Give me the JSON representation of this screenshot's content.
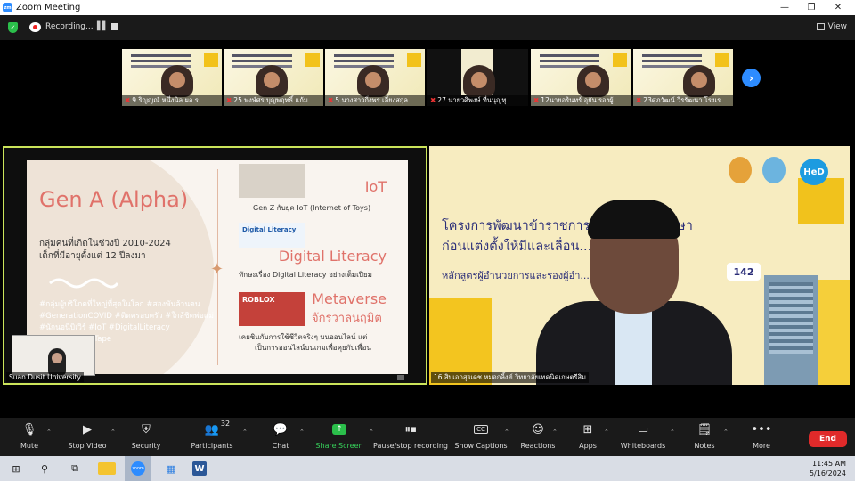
{
  "window": {
    "title": "Zoom Meeting",
    "minimize": "—",
    "restore": "❐",
    "close": "✕"
  },
  "topbar": {
    "recording_label": "Recording...",
    "view_label": "View"
  },
  "thumbnails": [
    {
      "name": "9 ริญญณ์ หนึ่งนิล ผอ.ร..."
    },
    {
      "name": "25 พงษ์ศร บุญพฤทธิ์ แก้ม..."
    },
    {
      "name": "5.นางสาวกิ่งพร เลี้ยงสกุล..."
    },
    {
      "name": "27 นายวศิพงษ์ ที่นนุญทุ..."
    },
    {
      "name": "12นายอรินทร์ อุยัน รองผู้..."
    },
    {
      "name": "23ศุภวัฒน์ วิรรัฒนา โรงเร..."
    }
  ],
  "left_panel": {
    "title": "Gen A (Alpha)",
    "line1": "กลุ่มคนที่เกิดในช่วงปี 2010-2024",
    "line2": "เด็กที่มีอายุตั้งแต่ 12 ปีลงมา",
    "tags": "#กลุ่มผู้บริโภคที่ใหญ่ที่สุดในโลก #สองพันล้านคน #GenerationCOVID #ติดครอบครัว #ใกล้ชิดพ่อแม่ #นักนอนิบิเวิร์ #IoT #DigitalLiteracy #Metaverse #Tape",
    "iot_heading": "IoT",
    "iot_sub": "Gen Z กับยุค IoT (Internet of Toys)",
    "dl_image_text": "Digital Literacy",
    "dl_heading": "Digital Literacy",
    "dl_sub": "ทักษะเรื่อง Digital Literacy อย่างเต็มเปี่ยม",
    "mv_heading": "Metaverse",
    "mv_thai": "จักรวาลนฤมิต",
    "mv_image_text": "ROBLOX",
    "mv_sub1": "เคยชินกับการใช้ชีวิตจริงๆ บนออนไลน์ แต่",
    "mv_sub2": "เป็นการออนไลน์บนเกมเพื่อคุยกับเพื่อน",
    "name_label": "Suan Dusit University"
  },
  "right_panel": {
    "title_line1": "โครงการพัฒนาข้าราชการ...กรทางการศึกษา",
    "title_line2": "ก่อนแต่งตั้งให้มีและเลื่อน...",
    "subtitle": "หลักสูตรผู้อำนวยการและรองผู้อำ...การพิเศษ ระยะที่",
    "badge": "142",
    "hed_logo": "HeD",
    "name_label": "16 สิบเอกสุรเดช  หมอกลิ้งข์ วิทยาลัยเทคนิคเกษตรีสิม"
  },
  "toolbar": {
    "mute": "Mute",
    "stop_video": "Stop Video",
    "security": "Security",
    "participants": "Participants",
    "participants_count": "32",
    "chat": "Chat",
    "share_screen": "Share Screen",
    "pause_recording": "Pause/stop recording",
    "show_captions": "Show Captions",
    "captions_icon_text": "CC",
    "reactions": "Reactions",
    "apps": "Apps",
    "whiteboards": "Whiteboards",
    "notes": "Notes",
    "more": "More",
    "end": "End"
  },
  "taskbar": {
    "time": "11:45 AM",
    "date": "5/16/2024"
  },
  "colors": {
    "zoom_blue": "#2d8cff",
    "active_speaker_border": "#cbe45a",
    "share_green": "#2bbf4b",
    "end_red": "#e02a2a"
  }
}
